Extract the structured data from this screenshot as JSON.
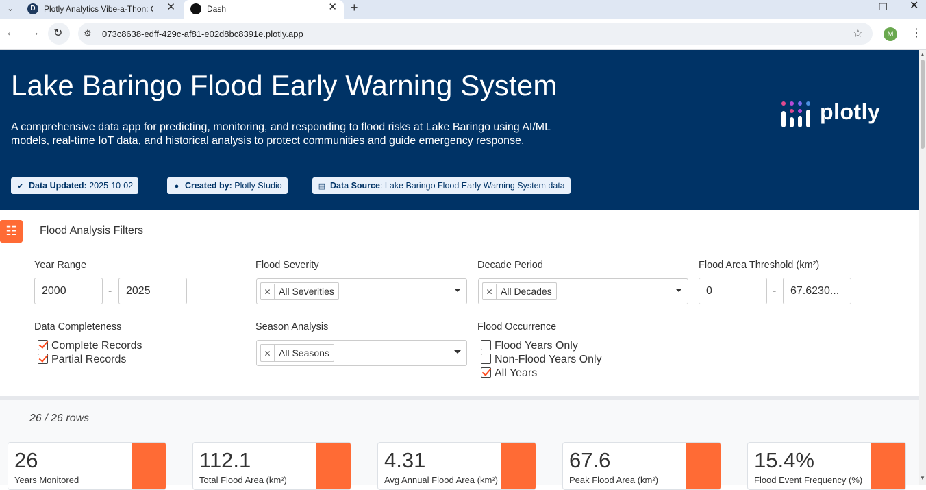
{
  "browser": {
    "tabs": [
      {
        "title": "Plotly Analytics Vibe-a-Thon: Co",
        "favicon": "D"
      },
      {
        "title": "Dash",
        "favicon": ""
      }
    ],
    "url": "073c8638-edff-429c-af81-e02d8bc8391e.plotly.app",
    "profile_initial": "M"
  },
  "header": {
    "title": "Lake Baringo Flood Early Warning System",
    "description": "A comprehensive data app for predicting, monitoring, and responding to flood risks at Lake Baringo using AI/ML models, real-time IoT data, and historical analysis to protect communities and guide emergency response.",
    "badges": [
      {
        "label": "Data Updated:",
        "value": "2025-10-02",
        "icon": "check-circle-icon"
      },
      {
        "label": "Created by:",
        "value": "Plotly Studio",
        "icon": "user-icon"
      },
      {
        "label": "Data Source",
        "value": ": Lake Baringo Flood Early Warning System data",
        "icon": "database-icon"
      }
    ],
    "logo_text": "plotly",
    "bg_color": "#003366"
  },
  "filters": {
    "title": "Flood Analysis Filters",
    "year_range": {
      "label": "Year Range",
      "from": "2000",
      "to": "2025",
      "sep": "-"
    },
    "flood_severity": {
      "label": "Flood Severity",
      "selected": "All Severities"
    },
    "decade_period": {
      "label": "Decade Period",
      "selected": "All Decades"
    },
    "area_threshold": {
      "label": "Flood Area Threshold (km²)",
      "from": "0",
      "to": "67.6230...",
      "sep": "-"
    },
    "data_completeness": {
      "label": "Data Completeness",
      "options": [
        {
          "label": "Complete Records",
          "checked": true
        },
        {
          "label": "Partial Records",
          "checked": true
        }
      ]
    },
    "season_analysis": {
      "label": "Season Analysis",
      "selected": "All Seasons"
    },
    "flood_occurrence": {
      "label": "Flood Occurrence",
      "options": [
        {
          "label": "Flood Years Only",
          "checked": false
        },
        {
          "label": "Non-Flood Years Only",
          "checked": false
        },
        {
          "label": "All Years",
          "checked": true
        }
      ]
    },
    "accent_color": "#ff6b35"
  },
  "stats": {
    "rows_text": "26 / 26 rows",
    "kpis": [
      {
        "value": "26",
        "label": "Years Monitored"
      },
      {
        "value": "112.1",
        "label": "Total Flood Area (km²)"
      },
      {
        "value": "4.31",
        "label": "Avg Annual Flood Area (km²)"
      },
      {
        "value": "67.6",
        "label": "Peak Flood Area (km²)"
      },
      {
        "value": "15.4%",
        "label": "Flood Event Frequency (%)"
      }
    ]
  }
}
